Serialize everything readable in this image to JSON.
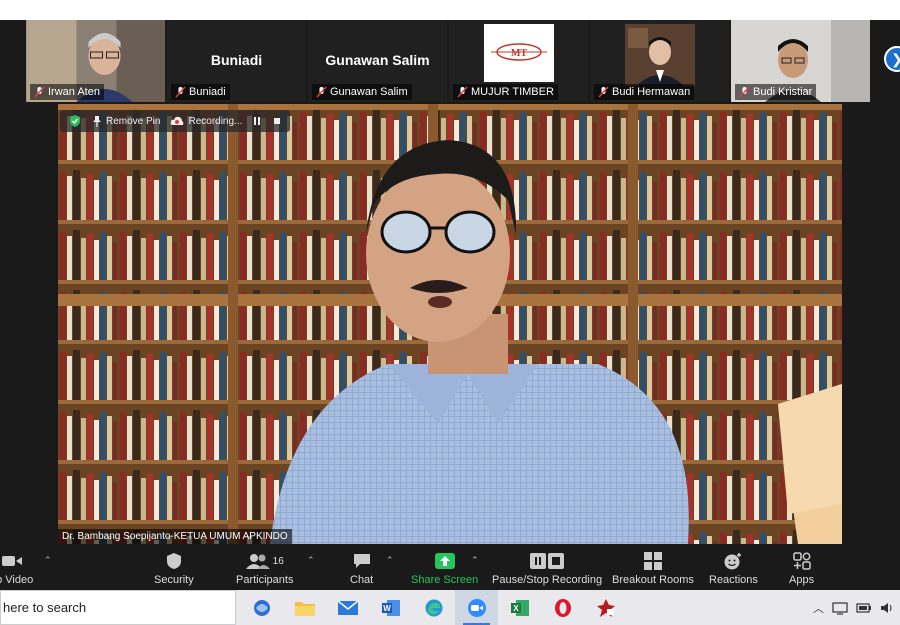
{
  "participants": [
    {
      "name": "Irwan Aten",
      "type": "video"
    },
    {
      "name": "Buniadi",
      "type": "name",
      "display": "Buniadi"
    },
    {
      "name": "Gunawan Salim",
      "type": "name",
      "display": "Gunawan Salim"
    },
    {
      "name": "MUJUR TIMBER",
      "type": "logo",
      "logo_text": "MT"
    },
    {
      "name": "Budi Hermawan",
      "type": "video"
    },
    {
      "name": "Budi Kristiar",
      "type": "video"
    }
  ],
  "recording_bar": {
    "remove_pin": "Remove Pin",
    "recording": "Recording..."
  },
  "main_video": {
    "speaker_label": "Dr. Bambang Soepijanto-KETUA UMUM APKINDO"
  },
  "toolbar": {
    "stop_video": "op Video",
    "security": "Security",
    "participants": "Participants",
    "participants_count": "16",
    "chat": "Chat",
    "share_screen": "Share Screen",
    "pause_stop_recording": "Pause/Stop Recording",
    "breakout_rooms": "Breakout Rooms",
    "reactions": "Reactions",
    "apps": "Apps"
  },
  "taskbar": {
    "search_placeholder": "here to search"
  },
  "colors": {
    "toolbar_bg": "#1a1a1a",
    "share_green": "#25c65c",
    "accent_blue": "#1a6fd1"
  }
}
